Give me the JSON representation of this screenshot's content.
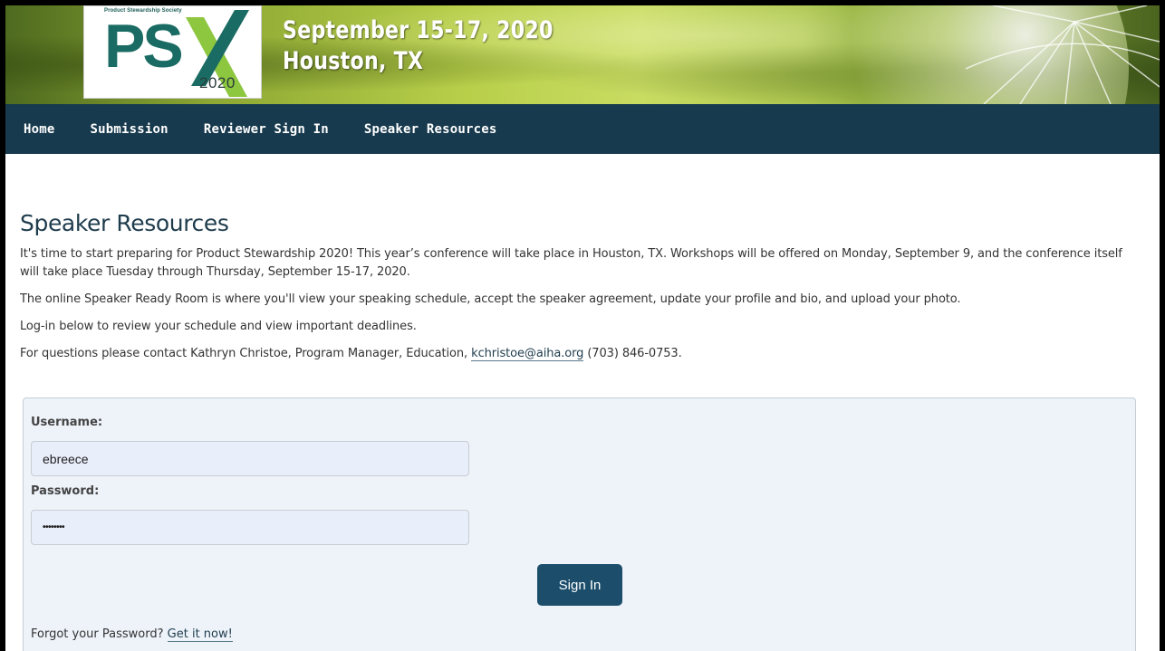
{
  "banner": {
    "logo_small_text": "Product Stewardship Society",
    "logo_ps": "PS",
    "logo_year": "2020",
    "event_date": "September 15-17, 2020",
    "event_city": "Houston, TX"
  },
  "nav": {
    "items": [
      {
        "label": "Home"
      },
      {
        "label": "Submission"
      },
      {
        "label": "Reviewer Sign In"
      },
      {
        "label": "Speaker Resources"
      }
    ]
  },
  "main": {
    "title": "Speaker Resources",
    "intro": "It's time to start preparing for Product Stewardship 2020! This year’s conference will take place in Houston, TX. Workshops will be offered on Monday, September 9, and the conference itself will take place Tuesday through Thursday, September 15-17, 2020.",
    "ready_room": "The online Speaker Ready Room is where you'll view your speaking schedule, accept the speaker agreement, update your profile and bio, and upload your photo.",
    "login_hint": "Log-in below to review your schedule and view important deadlines.",
    "contact_prefix": "For questions please contact Kathryn Christoe, Program Manager, Education,",
    "contact_email": "kchristoe@aiha.org",
    "contact_phone": "(703) 846-0753."
  },
  "login": {
    "username_label": "Username:",
    "username_value": "ebreece",
    "password_label": "Password:",
    "password_value": "••••••••",
    "submit_label": "Sign In",
    "forgot_text": "Forgot your Password?",
    "forgot_link": "Get it now!"
  },
  "colors": {
    "nav_bg": "#183a4e",
    "button_bg": "#1c4e6c",
    "logo_teal": "#1a6b63",
    "logo_green": "#8dc63f",
    "panel_bg": "#eef3fa"
  }
}
